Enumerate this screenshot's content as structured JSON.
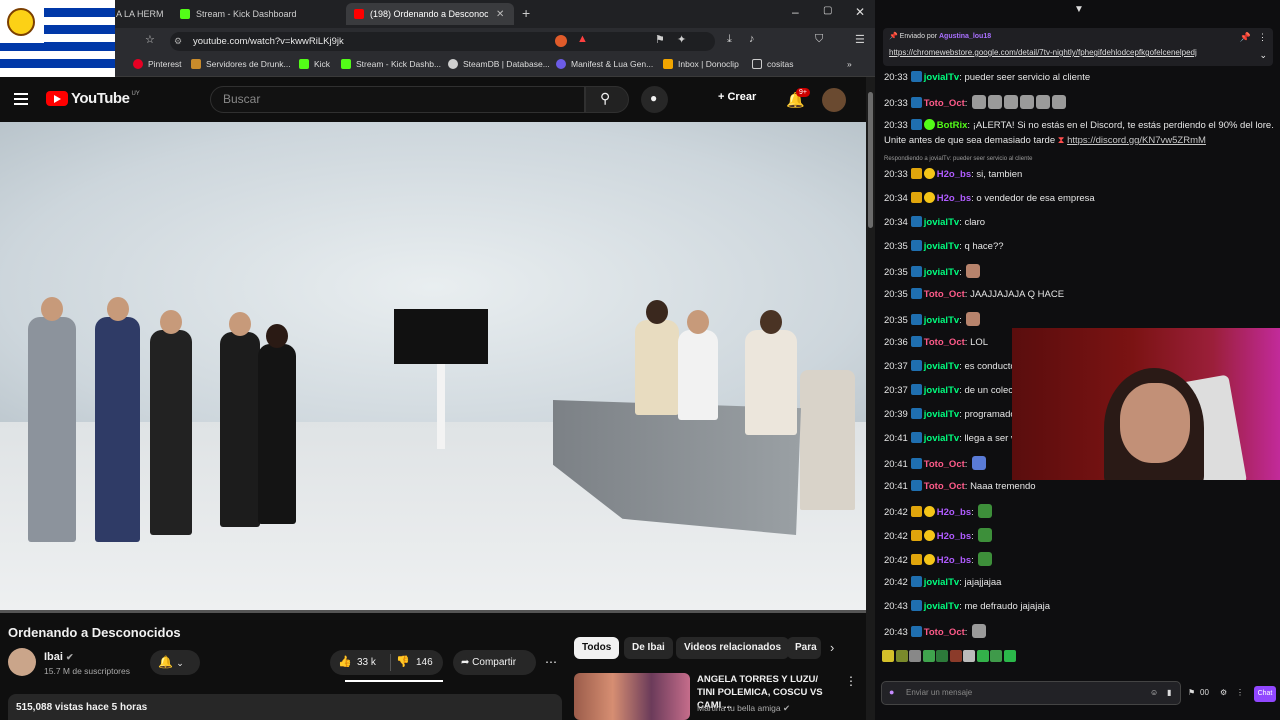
{
  "browser": {
    "tabs": [
      {
        "label": "A LA HERM",
        "active": false
      },
      {
        "label": "Stream - Kick Dashboard",
        "active": false
      },
      {
        "label": "(198) Ordenando a Desconoc",
        "active": true
      }
    ],
    "url": "youtube.com/watch?v=kwwRiLKj9jk",
    "bookmarks": [
      "Pinterest",
      "Servidores de Drunk...",
      "Kick",
      "Stream - Kick Dashb...",
      "SteamDB | Database...",
      "Manifest & Lua Gen...",
      "Inbox | Donoclip",
      "cositas"
    ],
    "new_tab_glyph": "+",
    "window_controls": [
      "–",
      "▢",
      "✕"
    ]
  },
  "youtube": {
    "logo_text": "YouTube",
    "country_code": "UY",
    "search_placeholder": "Buscar",
    "create_label": "+ Crear",
    "notification_count": "9+",
    "video_title": "Ordenando a Desconocidos",
    "progress": 0.0,
    "channel_name": "Ibai",
    "channel_subs": "15.7 M de suscriptores",
    "likes": "33 k",
    "dislikes": "146",
    "share_label": "Compartir",
    "views_line": "515,088 vistas  hace 5 horas",
    "chips": [
      "Todos",
      "De Ibai",
      "Videos relacionados",
      "Para"
    ],
    "recommended": {
      "title": "ANGELA TORRES Y LUZU/ TINI POLEMICA, COSCU VS CAMI ...",
      "channel": "Martina tu bella amiga"
    }
  },
  "chat": {
    "pinned_by": "Enviado por",
    "pinned_user": "Agustina_lou18",
    "pinned_url": "https://chromewebstore.google.com/detail/7tv-nightly/fphegifdehlodcepfkgofelcenelpedj",
    "reply_note": "Respondiendo a jovialTv: pueder seer servicio al cliente",
    "input_placeholder": "Enviar un mensaje",
    "chat_button": "Chat",
    "message_count_badge": "00",
    "messages": [
      {
        "time": "20:33",
        "user": "jovialTv",
        "color": "#00ff7f",
        "text": "pueder seer servicio al cliente"
      },
      {
        "time": "20:33",
        "user": "Toto_Oct",
        "color": "#ff5b8a",
        "text": ""
      },
      {
        "time": "20:33",
        "user": "BotRix",
        "color": "#53fc18",
        "text": "¡ALERTA! Si no estás en el Discord, te estás perdiendo el 90% del lore."
      },
      {
        "time": "",
        "user": "",
        "color": "#e6e6e6",
        "text": "Unite antes de que sea demasiado tarde"
      },
      {
        "time": "20:33",
        "user": "H2o_bs",
        "color": "#b05cff",
        "text": "si, tambien"
      },
      {
        "time": "20:34",
        "user": "H2o_bs",
        "color": "#b05cff",
        "text": "o vendedor de esa empresa"
      },
      {
        "time": "20:34",
        "user": "jovialTv",
        "color": "#00ff7f",
        "text": "claro"
      },
      {
        "time": "20:35",
        "user": "jovialTv",
        "color": "#00ff7f",
        "text": "q hace??"
      },
      {
        "time": "20:35",
        "user": "jovialTv",
        "color": "#00ff7f",
        "text": ""
      },
      {
        "time": "20:35",
        "user": "Toto_Oct",
        "color": "#ff5b8a",
        "text": "JAAJJAJAJA Q HACE"
      },
      {
        "time": "20:35",
        "user": "jovialTv",
        "color": "#00ff7f",
        "text": ""
      },
      {
        "time": "20:36",
        "user": "Toto_Oct",
        "color": "#ff5b8a",
        "text": "LOL"
      },
      {
        "time": "20:37",
        "user": "jovialTv",
        "color": "#00ff7f",
        "text": "es conductor"
      },
      {
        "time": "20:37",
        "user": "jovialTv",
        "color": "#00ff7f",
        "text": "de un colectivo"
      },
      {
        "time": "20:39",
        "user": "jovialTv",
        "color": "#00ff7f",
        "text": "programador segu"
      },
      {
        "time": "20:41",
        "user": "jovialTv",
        "color": "#00ff7f",
        "text": "llega a ser verdad"
      },
      {
        "time": "20:41",
        "user": "Toto_Oct",
        "color": "#ff5b8a",
        "text": ""
      },
      {
        "time": "20:41",
        "user": "Toto_Oct",
        "color": "#ff5b8a",
        "text": "Naaa tremendo"
      },
      {
        "time": "20:42",
        "user": "H2o_bs",
        "color": "#b05cff",
        "text": ""
      },
      {
        "time": "20:42",
        "user": "H2o_bs",
        "color": "#b05cff",
        "text": ""
      },
      {
        "time": "20:42",
        "user": "H2o_bs",
        "color": "#b05cff",
        "text": ""
      },
      {
        "time": "20:42",
        "user": "jovialTv",
        "color": "#00ff7f",
        "text": "jajajjajaa"
      },
      {
        "time": "20:43",
        "user": "jovialTv",
        "color": "#00ff7f",
        "text": "me defraudo jajajaja"
      },
      {
        "time": "20:43",
        "user": "Toto_Oct",
        "color": "#ff5b8a",
        "text": ""
      }
    ],
    "discord_link": "https://discord.gg/KN7vw5ZRmM"
  }
}
